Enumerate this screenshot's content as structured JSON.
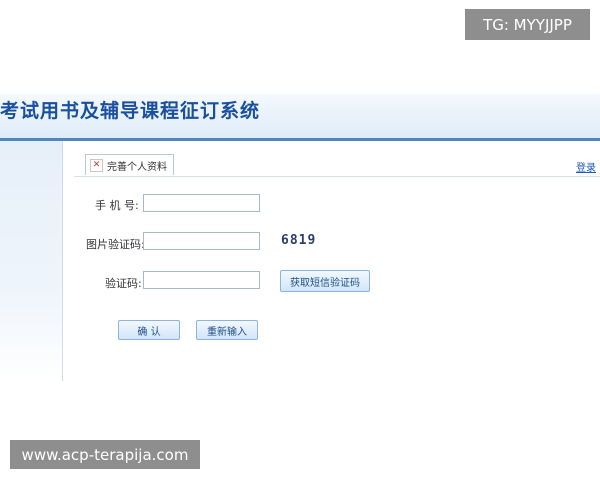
{
  "overlay": {
    "top_right_label": "TG: MYYJJPP",
    "bottom_left_label": "www.acp-terapija.com"
  },
  "header": {
    "title": "考试用书及辅导课程征订系统"
  },
  "tabs": [
    {
      "label": "完善个人资料",
      "close_icon": "close-icon"
    }
  ],
  "login_link": "登录",
  "form": {
    "phone": {
      "label": "手 机 号:",
      "value": ""
    },
    "image_captcha": {
      "label": "图片验证码:",
      "value": "",
      "captcha_text": "6819"
    },
    "sms_code": {
      "label": "验证码:",
      "value": "",
      "get_code_button": "获取短信验证码"
    },
    "buttons": {
      "confirm": "确 认",
      "reset": "重新输入"
    }
  }
}
